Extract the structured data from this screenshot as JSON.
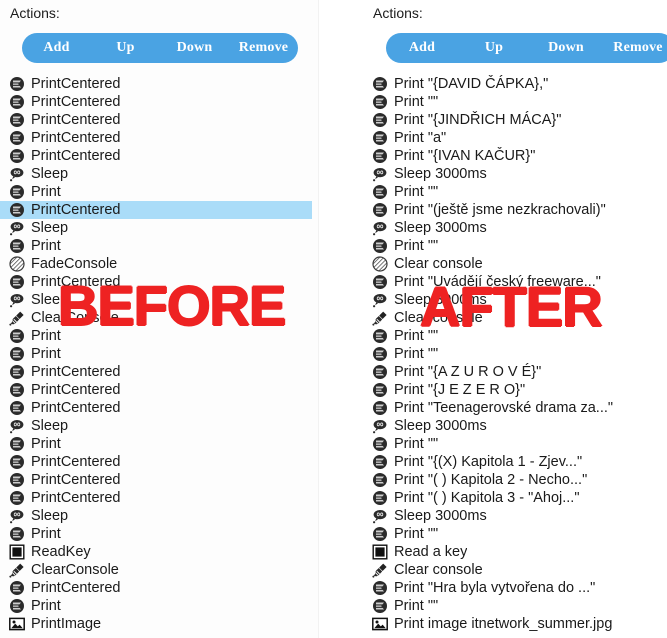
{
  "overlays": {
    "before": "BEFORE",
    "after": "AFTER"
  },
  "left_panel": {
    "caption": "Actions:",
    "toolbar": {
      "add": "Add",
      "up": "Up",
      "down": "Down",
      "remove": "Remove"
    },
    "selected_index": 7,
    "items": [
      {
        "icon": "print-icon",
        "label": "PrintCentered"
      },
      {
        "icon": "print-icon",
        "label": "PrintCentered"
      },
      {
        "icon": "print-icon",
        "label": "PrintCentered"
      },
      {
        "icon": "print-icon",
        "label": "PrintCentered"
      },
      {
        "icon": "print-icon",
        "label": "PrintCentered"
      },
      {
        "icon": "sleep-icon",
        "label": "Sleep"
      },
      {
        "icon": "print-icon",
        "label": "Print"
      },
      {
        "icon": "print-icon",
        "label": "PrintCentered"
      },
      {
        "icon": "sleep-icon",
        "label": "Sleep"
      },
      {
        "icon": "print-icon",
        "label": "Print"
      },
      {
        "icon": "fade-console-icon",
        "label": "FadeConsole"
      },
      {
        "icon": "print-icon",
        "label": "PrintCentered"
      },
      {
        "icon": "sleep-icon",
        "label": "Sleep"
      },
      {
        "icon": "clear-console-icon",
        "label": "ClearConsole"
      },
      {
        "icon": "print-icon",
        "label": "Print"
      },
      {
        "icon": "print-icon",
        "label": "Print"
      },
      {
        "icon": "print-icon",
        "label": "PrintCentered"
      },
      {
        "icon": "print-icon",
        "label": "PrintCentered"
      },
      {
        "icon": "print-icon",
        "label": "PrintCentered"
      },
      {
        "icon": "sleep-icon",
        "label": "Sleep"
      },
      {
        "icon": "print-icon",
        "label": "Print"
      },
      {
        "icon": "print-icon",
        "label": "PrintCentered"
      },
      {
        "icon": "print-icon",
        "label": "PrintCentered"
      },
      {
        "icon": "print-icon",
        "label": "PrintCentered"
      },
      {
        "icon": "sleep-icon",
        "label": "Sleep"
      },
      {
        "icon": "print-icon",
        "label": "Print"
      },
      {
        "icon": "read-key-icon",
        "label": "ReadKey"
      },
      {
        "icon": "clear-console-icon",
        "label": "ClearConsole"
      },
      {
        "icon": "print-icon",
        "label": "PrintCentered"
      },
      {
        "icon": "print-icon",
        "label": "Print"
      },
      {
        "icon": "print-image-icon",
        "label": "PrintImage"
      }
    ]
  },
  "right_panel": {
    "caption": "Actions:",
    "toolbar": {
      "add": "Add",
      "up": "Up",
      "down": "Down",
      "remove": "Remove"
    },
    "selected_index": -1,
    "items": [
      {
        "icon": "print-icon",
        "label": "Print \"{DAVID ČÁPKA},\""
      },
      {
        "icon": "print-icon",
        "label": "Print \"\""
      },
      {
        "icon": "print-icon",
        "label": "Print \"{JINDŘICH MÁCA}\""
      },
      {
        "icon": "print-icon",
        "label": "Print \"a\""
      },
      {
        "icon": "print-icon",
        "label": "Print \"{IVAN KAČUR}\""
      },
      {
        "icon": "sleep-icon",
        "label": "Sleep 3000ms"
      },
      {
        "icon": "print-icon",
        "label": "Print \"\""
      },
      {
        "icon": "print-icon",
        "label": "Print \"(ještě jsme nezkrachovali)\""
      },
      {
        "icon": "sleep-icon",
        "label": "Sleep 3000ms"
      },
      {
        "icon": "print-icon",
        "label": "Print \"\""
      },
      {
        "icon": "fade-console-icon",
        "label": "Clear console"
      },
      {
        "icon": "print-icon",
        "label": "Print \"Uvádějí český freeware...\""
      },
      {
        "icon": "sleep-icon",
        "label": "Sleep 3000ms"
      },
      {
        "icon": "clear-console-icon",
        "label": "Clear console"
      },
      {
        "icon": "print-icon",
        "label": "Print \"\""
      },
      {
        "icon": "print-icon",
        "label": "Print \"\""
      },
      {
        "icon": "print-icon",
        "label": "Print \"{A Z U R O V É}\""
      },
      {
        "icon": "print-icon",
        "label": "Print \"{J E Z E R O}\""
      },
      {
        "icon": "print-icon",
        "label": "Print \"Teenagerovské drama za...\""
      },
      {
        "icon": "sleep-icon",
        "label": "Sleep 3000ms"
      },
      {
        "icon": "print-icon",
        "label": "Print \"\""
      },
      {
        "icon": "print-icon",
        "label": "Print \"{(X) Kapitola 1 - Zjev...\""
      },
      {
        "icon": "print-icon",
        "label": "Print \"( ) Kapitola 2 - Necho...\""
      },
      {
        "icon": "print-icon",
        "label": "Print \"( ) Kapitola 3 - \"Ahoj...\""
      },
      {
        "icon": "sleep-icon",
        "label": "Sleep 3000ms"
      },
      {
        "icon": "print-icon",
        "label": "Print \"\""
      },
      {
        "icon": "read-key-icon",
        "label": "Read a key"
      },
      {
        "icon": "clear-console-icon",
        "label": "Clear console"
      },
      {
        "icon": "print-icon",
        "label": "Print \"Hra byla vytvořena do ...\""
      },
      {
        "icon": "print-icon",
        "label": "Print \"\""
      },
      {
        "icon": "print-image-icon",
        "label": "Print image itnetwork_summer.jpg"
      }
    ]
  },
  "colors": {
    "toolbar_background": "#4aa3e3",
    "selection_background": "#aadcf8",
    "overlay_red": "#ee2222",
    "text": "#1a1a1a"
  }
}
